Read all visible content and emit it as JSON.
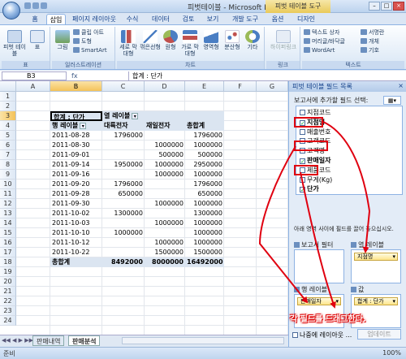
{
  "window": {
    "title": "피벗테이블 - Microsoft Excel",
    "context_tab": "피벗 테이블 도구"
  },
  "tabs": [
    "홈",
    "삽입",
    "페이지 레이아웃",
    "수식",
    "데이터",
    "검토",
    "보기",
    "개발 도구",
    "옵션",
    "디자인"
  ],
  "active_tab": "삽입",
  "ribbon": {
    "groups": [
      {
        "label": "표",
        "buttons": [
          "피벗 테이블",
          "표"
        ]
      },
      {
        "label": "일러스트레이션",
        "buttons": [
          "그림",
          "클립 아트",
          "도형",
          "SmartArt"
        ]
      },
      {
        "label": "차트",
        "buttons": [
          "세로 막대형",
          "꺾은선형",
          "원형",
          "가로 막대형",
          "영역형",
          "분산형",
          "기타"
        ]
      },
      {
        "label": "링크",
        "buttons": [
          "하이퍼링크"
        ]
      },
      {
        "label": "텍스트",
        "buttons": [
          "텍스트 상자",
          "머리글/바닥글",
          "WordArt",
          "서명란",
          "개체",
          "기호"
        ]
      }
    ]
  },
  "formula_bar": {
    "cell": "B3",
    "fx": "fx",
    "value": "합계 : 단가"
  },
  "columns": [
    "A",
    "B",
    "C",
    "D",
    "E",
    "F",
    "G"
  ],
  "rows": [
    "1",
    "2",
    "3",
    "4",
    "5",
    "6",
    "7",
    "8",
    "9",
    "10",
    "11",
    "12",
    "13",
    "14",
    "15",
    "16",
    "17",
    "18",
    "19",
    "20",
    "21",
    "22",
    "23",
    "24"
  ],
  "pivot": {
    "value_header": "합계 : 단가",
    "col_label": "열 레이블",
    "row_label": "행 레이블",
    "col_fields": [
      "대륙전자",
      "재일전자",
      "총합계"
    ],
    "data": [
      [
        "2011-08-28",
        "1796000",
        "",
        "1796000"
      ],
      [
        "2011-08-30",
        "",
        "1000000",
        "1000000"
      ],
      [
        "2011-09-01",
        "",
        "500000",
        "500000"
      ],
      [
        "2011-09-14",
        "1950000",
        "1000000",
        "2950000"
      ],
      [
        "2011-09-16",
        "",
        "1000000",
        "1000000"
      ],
      [
        "2011-09-20",
        "1796000",
        "",
        "1796000"
      ],
      [
        "2011-09-28",
        "650000",
        "",
        "650000"
      ],
      [
        "2011-09-30",
        "",
        "1000000",
        "1000000"
      ],
      [
        "2011-10-02",
        "1300000",
        "",
        "1300000"
      ],
      [
        "2011-10-03",
        "",
        "1000000",
        "1000000"
      ],
      [
        "2011-10-10",
        "1000000",
        "",
        "1000000"
      ],
      [
        "2011-10-12",
        "",
        "1000000",
        "1000000"
      ],
      [
        "2011-10-22",
        "",
        "1500000",
        "1500000"
      ]
    ],
    "total": [
      "총합계",
      "8492000",
      "8000000",
      "16492000"
    ]
  },
  "sheet_tabs": [
    "판매내역",
    "판매분석"
  ],
  "active_sheet": "판매분석",
  "status": {
    "text": "준비",
    "zoom": "100%"
  },
  "taskpane": {
    "title": "피벗 테이블 필드 목록",
    "prompt": "보고서에 추가할 필드 선택:",
    "fields": [
      {
        "name": "지점코드",
        "checked": false
      },
      {
        "name": "지점명",
        "checked": true
      },
      {
        "name": "매출번호",
        "checked": false
      },
      {
        "name": "고객코드",
        "checked": false
      },
      {
        "name": "고객명",
        "checked": false
      },
      {
        "name": "판매일자",
        "checked": true
      },
      {
        "name": "제품코드",
        "checked": false
      },
      {
        "name": "무게(Kg)",
        "checked": false
      },
      {
        "name": "단가",
        "checked": true
      }
    ],
    "drag_prompt": "아래 영역 사이에 필드를 끌어 놓으십시오.",
    "areas": {
      "report_filter": "보고서 필터",
      "column_labels": "열 레이블",
      "row_labels": "행 레이블",
      "values": "값"
    },
    "column_chip": "지점명",
    "row_chip": "판매일자",
    "value_chip": "합계 : 단가",
    "defer_label": "나중에 레이아웃 ...",
    "update_button": "업데이트"
  },
  "annotation": "각 필드를 드래그한다.",
  "colors": {
    "annotation_red": "#e00010",
    "pivot_fill": "#dbe5f1",
    "chip_fill": "#fde58a"
  }
}
